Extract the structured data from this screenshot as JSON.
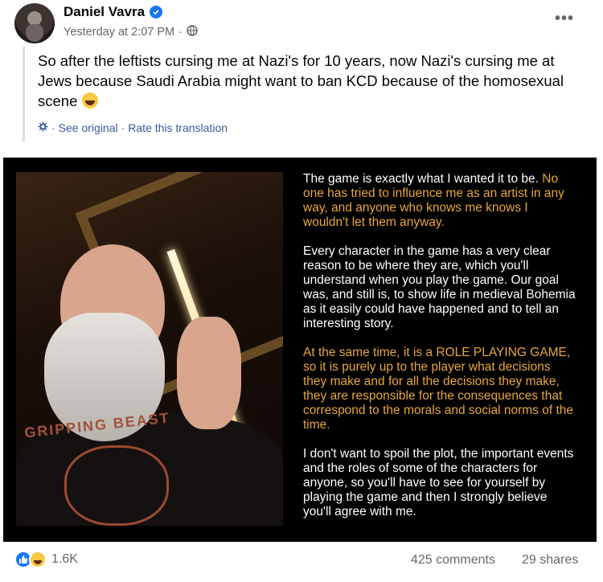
{
  "post": {
    "author": "Daniel Vavra",
    "timestamp": "Yesterday at 2:07 PM",
    "privacy_icon": "globe-icon",
    "verified_icon": "verified-badge-icon",
    "more_label": "•••",
    "text": "So after the leftists cursing me at Nazi's for 10 years, now Nazi's cursing me at Jews because Saudi Arabia might want to ban KCD because of the homosexual scene",
    "translation": {
      "see_original": "See original",
      "separator": "·",
      "rate": "Rate this translation"
    }
  },
  "image": {
    "shirt_text": "GRIPPING BEAST",
    "paragraphs": [
      {
        "white": "The game is exactly what I wanted it to be.",
        "yellow": "No one has tried to influence me as an artist in any way, and anyone who knows me knows I wouldn't let them anyway."
      },
      {
        "white": "Every character in the game has a very clear reason to be where they are, which you'll understand when you play the game. Our goal was, and still is, to show life in medieval Bohemia as it easily could have happened and to tell an interesting story.",
        "yellow": ""
      },
      {
        "white": "",
        "yellow": "At the same time, it is a ROLE PLAYING GAME, so it is purely up to the player what decisions they make and for all the decisions they make, they are responsible for the consequences that correspond to the morals and social norms of the time."
      },
      {
        "white": "I don't want to spoil the plot, the important events and the roles of some of the characters for anyone, so you'll have to see for yourself by playing the game and then I strongly believe you'll agree with me.",
        "yellow": ""
      }
    ]
  },
  "footer": {
    "reaction_count": "1.6K",
    "comments": "425 comments",
    "shares": "29 shares"
  },
  "colors": {
    "link": "#385898",
    "muted": "#65676b",
    "brand_blue": "#1877f2",
    "image_yellow": "#e6a73a"
  }
}
